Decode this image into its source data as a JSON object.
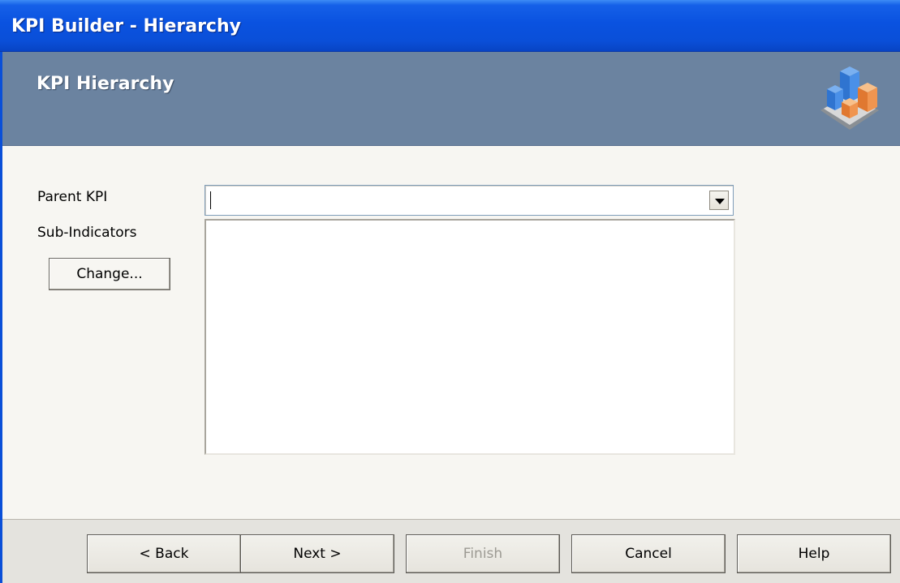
{
  "window": {
    "title": "KPI Builder - Hierarchy"
  },
  "banner": {
    "title": "KPI Hierarchy",
    "icon": "kpi-chart-icon"
  },
  "form": {
    "parent_kpi_label": "Parent KPI",
    "parent_kpi_value": "",
    "sub_indicators_label": "Sub-Indicators",
    "sub_indicators": [],
    "change_button_label": "Change..."
  },
  "footer": {
    "back_label": "< Back",
    "next_label": "Next >",
    "finish_label": "Finish",
    "finish_enabled": false,
    "cancel_label": "Cancel",
    "help_label": "Help"
  },
  "colors": {
    "titlebar": "#0a52e0",
    "banner": "#6b83a0",
    "content_bg": "#f7f6f2",
    "footer_bg": "#e4e3de"
  }
}
